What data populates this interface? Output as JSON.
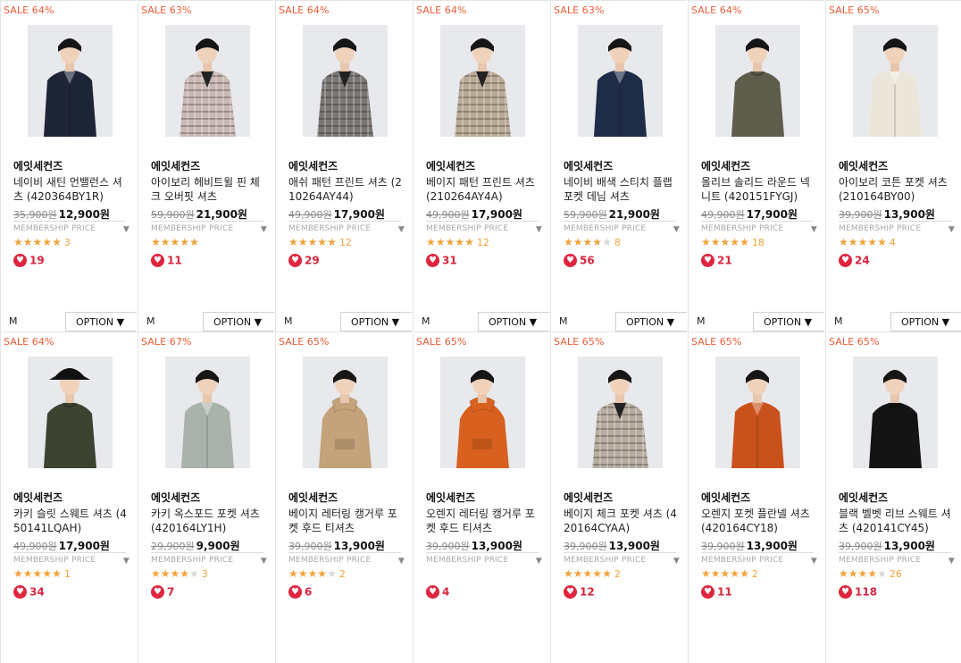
{
  "common": {
    "membership_label": "MEMBERSHIP PRICE",
    "membership_arrow": "▼",
    "option_label": "OPTION ▼",
    "heart_icon": "heart-icon",
    "star_color": "#f2a33a",
    "sale_color": "#ee5b35",
    "heart_color": "#e0253f"
  },
  "products": [
    {
      "sale": "SALE 64%",
      "brand": "에잇세컨즈",
      "name": "네이비 새틴 언밸런스 셔츠 (420364BY1R)",
      "orig": "35,900원",
      "price": "12,900원",
      "stars": 5,
      "rcount": "3",
      "likes": "19",
      "size": "M",
      "photo": {
        "shirt": "#1e2536",
        "pants": "#2a2a2a",
        "type": "shirt"
      }
    },
    {
      "sale": "SALE 63%",
      "brand": "에잇세컨즈",
      "name": "아이보리 헤비트윌 핀 체크 오버핏 셔츠",
      "orig": "59,900원",
      "price": "21,900원",
      "stars": 5,
      "rcount": "",
      "likes": "11",
      "size": "M",
      "photo": {
        "shirt": "#c9b8b4",
        "pants": "#2e2e32",
        "type": "check"
      }
    },
    {
      "sale": "SALE 64%",
      "brand": "에잇세컨즈",
      "name": "애쉬 패턴 프린트 셔츠 (210264AY44)",
      "orig": "49,900원",
      "price": "17,900원",
      "stars": 5,
      "rcount": "12",
      "likes": "29",
      "size": "M",
      "photo": {
        "shirt": "#7a7774",
        "pants": "#2b2b2b",
        "type": "pattern"
      }
    },
    {
      "sale": "SALE 64%",
      "brand": "에잇세컨즈",
      "name": "베이지 패턴 프린트 셔츠 (210264AY4A)",
      "orig": "49,900원",
      "price": "17,900원",
      "stars": 5,
      "rcount": "12",
      "likes": "31",
      "size": "M",
      "photo": {
        "shirt": "#b9aa96",
        "pants": "#3a3a3a",
        "type": "pattern"
      }
    },
    {
      "sale": "SALE 63%",
      "brand": "에잇세컨즈",
      "name": "네이비 배색 스티치 플랩 포켓 데님 셔츠",
      "orig": "59,900원",
      "price": "21,900원",
      "stars": 4,
      "rcount": "8",
      "likes": "56",
      "size": "M",
      "photo": {
        "shirt": "#1f2c47",
        "pants": "#c8c3b8",
        "type": "shirt"
      }
    },
    {
      "sale": "SALE 64%",
      "brand": "에잇세컨즈",
      "name": "올리브 솔리드 라운드 넥 니트 (420151FYGJ)",
      "orig": "49,900원",
      "price": "17,900원",
      "stars": 5,
      "rcount": "18",
      "likes": "21",
      "size": "M",
      "photo": {
        "shirt": "#5e5c4a",
        "pants": "#2f2f2f",
        "type": "knit"
      }
    },
    {
      "sale": "SALE 65%",
      "brand": "에잇세컨즈",
      "name": "아이보리 코튼 포켓 셔츠 (210164BY00)",
      "orig": "39,900원",
      "price": "13,900원",
      "stars": 5,
      "rcount": "4",
      "likes": "24",
      "size": "M",
      "photo": {
        "shirt": "#ece6da",
        "pants": "#d9d6cf",
        "type": "shirt"
      }
    },
    {
      "sale": "SALE 64%",
      "brand": "에잇세컨즈",
      "name": "카키 슬릿 스웨트 셔츠 (450141LQAH)",
      "orig": "49,900원",
      "price": "17,900원",
      "stars": 5,
      "rcount": "1",
      "likes": "34",
      "size": "",
      "photo": {
        "shirt": "#3c4330",
        "pants": "#2a2a2a",
        "type": "hat"
      }
    },
    {
      "sale": "SALE 67%",
      "brand": "에잇세컨즈",
      "name": "카키 옥스포드 포켓 셔츠 (420164LY1H)",
      "orig": "29,900원",
      "price": "9,900원",
      "stars": 4,
      "rcount": "3",
      "likes": "7",
      "size": "",
      "photo": {
        "shirt": "#a9b2ab",
        "pants": "#2a2a2a",
        "type": "shirt"
      }
    },
    {
      "sale": "SALE 65%",
      "brand": "에잇세컨즈",
      "name": "베이지 레터링 캥거루 포켓 후드 티셔츠",
      "orig": "39,900원",
      "price": "13,900원",
      "stars": 4,
      "rcount": "2",
      "likes": "6",
      "size": "",
      "photo": {
        "shirt": "#c4a27a",
        "pants": "#3a3a3a",
        "type": "hood"
      }
    },
    {
      "sale": "SALE 65%",
      "brand": "에잇세컨즈",
      "name": "오렌지 레터링 캥거루 포켓 후드 티셔츠",
      "orig": "39,900원",
      "price": "13,900원",
      "stars": 0,
      "rcount": "",
      "likes": "4",
      "size": "",
      "photo": {
        "shirt": "#d8611f",
        "pants": "#2a2a2a",
        "type": "hood"
      }
    },
    {
      "sale": "SALE 65%",
      "brand": "에잇세컨즈",
      "name": "베이지 체크 포켓 셔츠 (420164CYAA)",
      "orig": "39,900원",
      "price": "13,900원",
      "stars": 5,
      "rcount": "2",
      "likes": "12",
      "size": "",
      "photo": {
        "shirt": "#b7aca0",
        "pants": "#2a2a2a",
        "type": "check"
      }
    },
    {
      "sale": "SALE 65%",
      "brand": "에잇세컨즈",
      "name": "오렌지 포켓 플란넬 셔츠 (420164CY18)",
      "orig": "39,900원",
      "price": "13,900원",
      "stars": 5,
      "rcount": "2",
      "likes": "11",
      "size": "",
      "photo": {
        "shirt": "#c9521c",
        "pants": "#2a2a2a",
        "type": "shirt"
      }
    },
    {
      "sale": "SALE 65%",
      "brand": "에잇세컨즈",
      "name": "블랙 벨벳 리브 스웨트 셔츠 (420141CY45)",
      "orig": "39,900원",
      "price": "13,900원",
      "stars": 4,
      "rcount": "26",
      "likes": "118",
      "size": "",
      "photo": {
        "shirt": "#141414",
        "pants": "#2a2a2a",
        "type": "knit"
      }
    }
  ]
}
